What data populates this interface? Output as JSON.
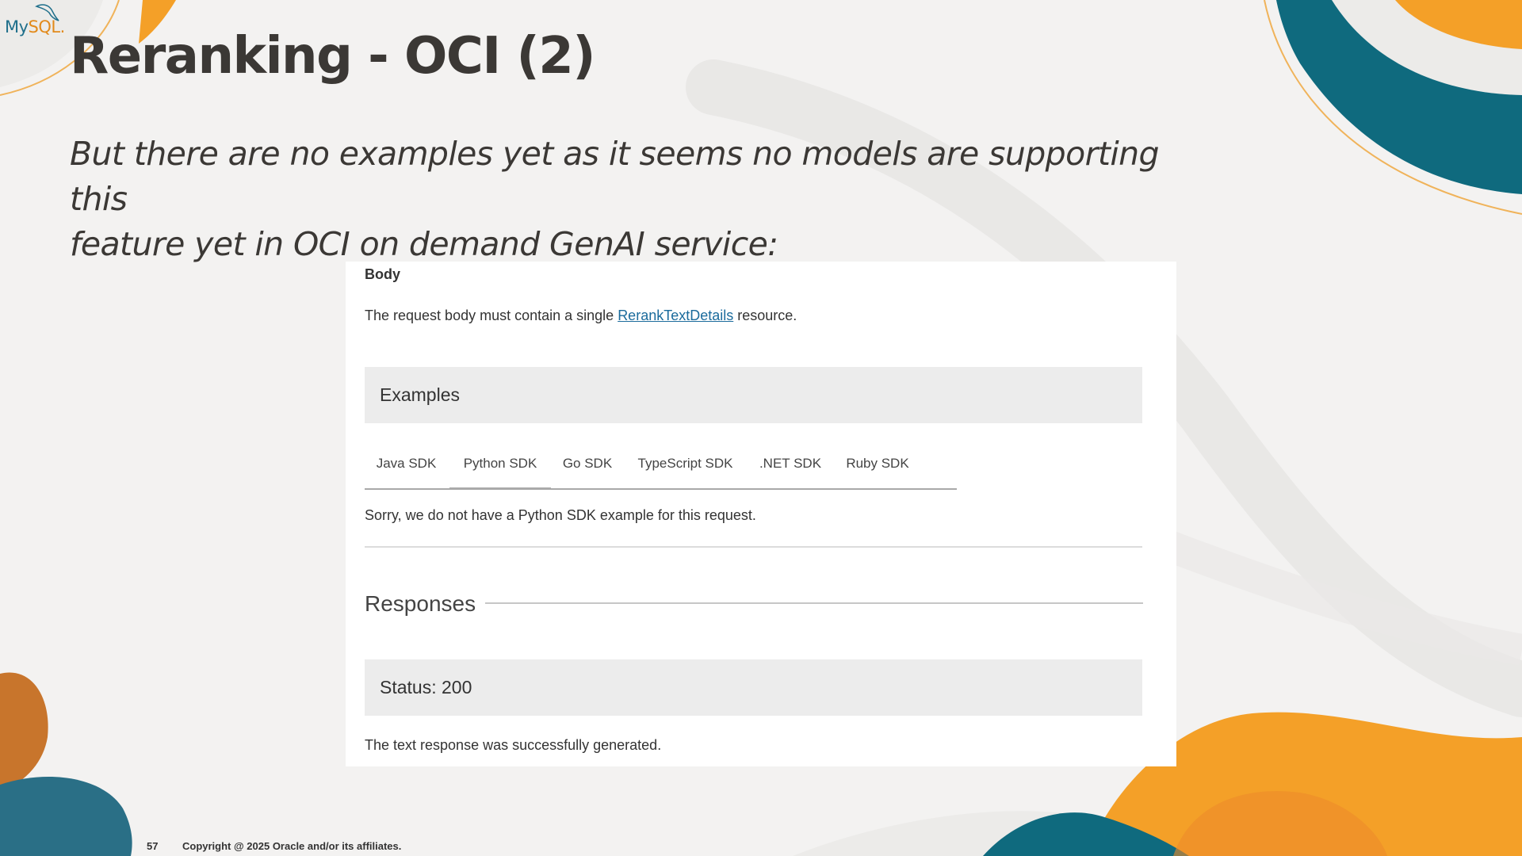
{
  "logo": {
    "text_my": "My",
    "text_sql": "SQL",
    "text_suffix": "."
  },
  "slide": {
    "title": "Reranking - OCI (2)",
    "subtitle_line1": "But there are no examples yet as it seems no models are supporting this",
    "subtitle_line2": "feature yet in OCI on demand GenAI service:",
    "page_number": "57",
    "copyright": "Copyright @ 2025 Oracle and/or its affiliates."
  },
  "doc": {
    "body_heading": "Body",
    "body_text_before": "The request body must contain a single ",
    "body_link": "RerankTextDetails",
    "body_text_after": " resource.",
    "examples_heading": "Examples",
    "tabs": [
      {
        "label": "Java SDK"
      },
      {
        "label": "Python SDK",
        "active": true
      },
      {
        "label": "Go SDK"
      },
      {
        "label": "TypeScript SDK"
      },
      {
        "label": ".NET SDK"
      },
      {
        "label": "Ruby SDK"
      }
    ],
    "no_example_text": "Sorry, we do not have a Python SDK example for this request.",
    "responses_heading": "Responses",
    "status_heading": "Status: 200",
    "status_text": "The text response was successfully generated."
  },
  "colors": {
    "background": "#f3f2f1",
    "teal": "#0f6a7e",
    "orange": "#f4a028",
    "brown_orange": "#c8752c",
    "link": "#1b6b9c"
  }
}
